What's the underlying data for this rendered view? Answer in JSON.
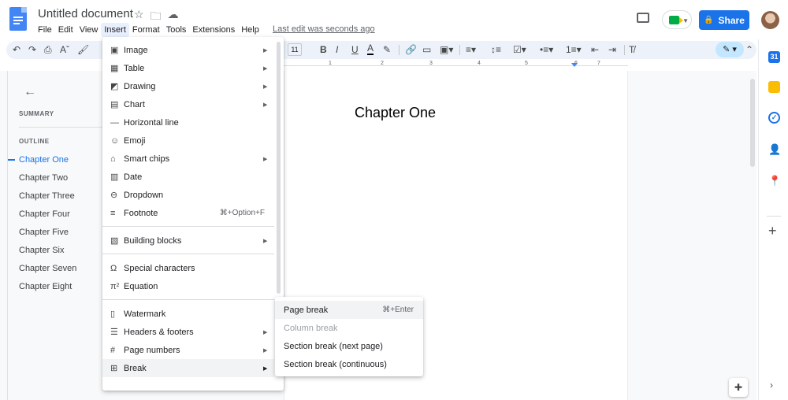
{
  "doc": {
    "title": "Untitled document",
    "last_edit": "Last edit was seconds ago"
  },
  "menubar": [
    "File",
    "Edit",
    "View",
    "Insert",
    "Format",
    "Tools",
    "Extensions",
    "Help"
  ],
  "menubar_active": "Insert",
  "share_label": "Share",
  "toolbar": {
    "font_size": "11",
    "bold": "B",
    "italic": "I",
    "underline": "U",
    "text_color": "A"
  },
  "ruler_numbers": [
    "1",
    "2",
    "3",
    "4",
    "5",
    "6",
    "7"
  ],
  "outline": {
    "summary_label": "SUMMARY",
    "outline_label": "OUTLINE",
    "items": [
      "Chapter One",
      "Chapter Two",
      "Chapter Three",
      "Chapter Four",
      "Chapter Five",
      "Chapter Six",
      "Chapter Seven",
      "Chapter Eight"
    ],
    "active_item": "Chapter One"
  },
  "page": {
    "heading": "Chapter One"
  },
  "insert_menu": {
    "items": [
      {
        "label": "Image",
        "icon": "image-icon",
        "submenu": true
      },
      {
        "label": "Table",
        "icon": "table-icon",
        "submenu": true
      },
      {
        "label": "Drawing",
        "icon": "drawing-icon",
        "submenu": true
      },
      {
        "label": "Chart",
        "icon": "chart-icon",
        "submenu": true
      },
      {
        "label": "Horizontal line",
        "icon": "horizontal-line-icon",
        "submenu": false
      },
      {
        "label": "Emoji",
        "icon": "emoji-icon",
        "submenu": false
      },
      {
        "label": "Smart chips",
        "icon": "smart-chips-icon",
        "submenu": true
      },
      {
        "label": "Date",
        "icon": "date-icon",
        "submenu": false
      },
      {
        "label": "Dropdown",
        "icon": "dropdown-icon",
        "submenu": false
      },
      {
        "label": "Footnote",
        "icon": "footnote-icon",
        "submenu": false,
        "shortcut": "⌘+Option+F"
      },
      {
        "label": "Building blocks",
        "icon": "building-blocks-icon",
        "submenu": true
      },
      {
        "label": "Special characters",
        "icon": "omega-icon",
        "submenu": false
      },
      {
        "label": "Equation",
        "icon": "equation-icon",
        "submenu": false
      },
      {
        "label": "Watermark",
        "icon": "watermark-icon",
        "submenu": false
      },
      {
        "label": "Headers & footers",
        "icon": "headers-footers-icon",
        "submenu": true
      },
      {
        "label": "Page numbers",
        "icon": "page-numbers-icon",
        "submenu": true
      },
      {
        "label": "Break",
        "icon": "break-icon",
        "submenu": true,
        "highlighted": true
      }
    ]
  },
  "break_menu": {
    "items": [
      {
        "label": "Page break",
        "shortcut": "⌘+Enter",
        "highlighted": true
      },
      {
        "label": "Column break",
        "disabled": true
      },
      {
        "label": "Section break (next page)"
      },
      {
        "label": "Section break (continuous)"
      }
    ]
  },
  "colors": {
    "accent": "#1a73e8",
    "share_bg": "#1a73e8",
    "toolbar_bg": "#edf2fa"
  }
}
